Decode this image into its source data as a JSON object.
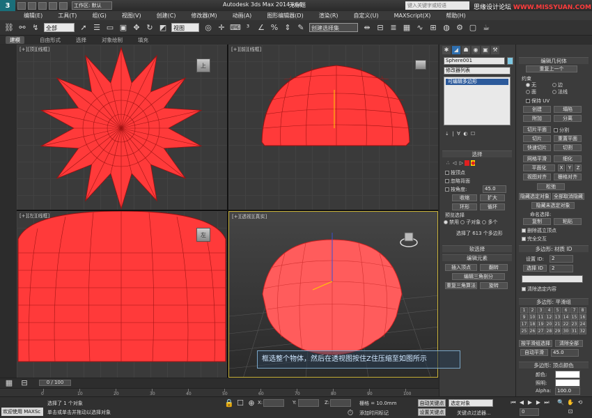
{
  "titlebar": {
    "logo": "3",
    "workspace": "工作区: 默认",
    "app_title": "Autodesk 3ds Max  2014 x64",
    "doc_title": "无标题",
    "search_placeholder": "键入关键字或短语",
    "watermark_cn": "思缘设计论坛",
    "watermark_url": "WWW.MISSYUAN.COM"
  },
  "menu": [
    "编辑(E)",
    "工具(T)",
    "组(G)",
    "视图(V)",
    "创建(C)",
    "修改器(M)",
    "动画(A)",
    "图形编辑器(D)",
    "渲染(R)",
    "自定义(U)",
    "MAXScript(X)",
    "帮助(H)"
  ],
  "toolbar": {
    "selection_filter": "全部",
    "ref_coord": "视图",
    "named_selection": "创建选择集"
  },
  "ribbon": {
    "tabs": [
      "建模",
      "自由形式",
      "选择",
      "对象绘制",
      "填充"
    ]
  },
  "viewports": {
    "top": "[+][顶][线框]",
    "front": "[+][前][线框]",
    "left": "[+][左][线框]",
    "persp": "[+][透视][真实]",
    "viewcube_top": "上",
    "viewcube_left": "左"
  },
  "caption": "框选整个物体，然后在透视图按住Z住压缩至如图所示",
  "command_panel": {
    "object_name": "Sphere001",
    "modifier_list": "修改器列表",
    "stack_item": "可编辑多边形",
    "selection_title": "选择",
    "by_vertex": "按顶点",
    "ignore_backface": "忽略背面",
    "by_angle": "按角度:",
    "angle_value": "45.0",
    "shrink": "收缩",
    "grow": "扩大",
    "ring": "环形",
    "loop": "循环",
    "preview_title": "预览选择",
    "preview_off": "禁用",
    "preview_sub": "子对象",
    "preview_multi": "多个",
    "selected_info": "选择了 613 个多边形",
    "soft_sel": "软选择",
    "edit_elements": "编辑元素",
    "insert_vertex": "插入顶点",
    "flip": "翻转",
    "edit_tri": "编辑三角剖分",
    "retriangulate": "重复三角算法",
    "rotate": "旋转"
  },
  "command_panel2": {
    "edit_geometry": "编辑几何体",
    "repeat_last": "重复上一个",
    "constraints": "约束",
    "c_none": "无",
    "c_edge": "边",
    "c_face": "面",
    "c_normal": "法线",
    "preserve_uv": "保持 UV",
    "create": "创建",
    "collapse": "塌陷",
    "attach": "附加",
    "detach": "分离",
    "slice_plane": "切片平面",
    "split": "分割",
    "slice": "切片",
    "reset_plane": "重置平面",
    "quickslice": "快速切片",
    "cut": "切割",
    "meshsmooth": "网格平滑",
    "tessellate": "细化",
    "planarize": "平面化",
    "x": "X",
    "y": "Y",
    "z": "Z",
    "view_align": "视图对齐",
    "grid_align": "栅格对齐",
    "relax": "松弛",
    "hide_selected": "隐藏选定对象",
    "unhide_all": "全部取消隐藏",
    "hide_unselected": "隐藏未选定对象",
    "named_sel": "命名选择:",
    "copy": "复制",
    "paste": "粘贴",
    "delete_iso": "删除孤立顶点",
    "full_interact": "完全交互",
    "mat_id_title": "多边形: 材质 ID",
    "set_id": "设置 ID:",
    "set_id_val": "2",
    "select_id": "选择 ID",
    "select_id_val": "2",
    "clear_sel": "清除选定内容",
    "smoothing_title": "多边形: 平滑组",
    "sg_numbers": [
      "1",
      "2",
      "3",
      "4",
      "5",
      "6",
      "7",
      "8",
      "9",
      "10",
      "11",
      "12",
      "13",
      "14",
      "15",
      "16",
      "17",
      "18",
      "19",
      "20",
      "21",
      "22",
      "23",
      "24",
      "25",
      "26",
      "27",
      "28",
      "29",
      "30",
      "31",
      "32"
    ],
    "select_by_sg": "按平滑组选择",
    "clear_all": "清除全部",
    "auto_smooth": "自动平滑",
    "auto_smooth_val": "45.0",
    "vertex_color_title": "多边形: 顶点颜色",
    "color": "颜色:",
    "illum": "照明:",
    "alpha": "Alpha:",
    "alpha_val": "100.0"
  },
  "timeline": {
    "frame": "0 / 100",
    "ticks": [
      "0",
      "10",
      "20",
      "30",
      "40",
      "50",
      "60",
      "70",
      "80",
      "90",
      "100"
    ]
  },
  "status": {
    "welcome": "欢迎使用 MAXSc",
    "line1": "选择了 1 个对象",
    "line2": "单击或单击并拖动以选择对象",
    "x_label": "X:",
    "y_label": "Y:",
    "z_label": "Z:",
    "grid": "栅格 = 10.0mm",
    "add_time_tag": "添加时间标记",
    "auto_key": "自动关键点",
    "set_key": "设置关键点",
    "key_filter": "选定对象",
    "key_filters_btn": "关键点过滤器...",
    "frame_num": "0"
  }
}
